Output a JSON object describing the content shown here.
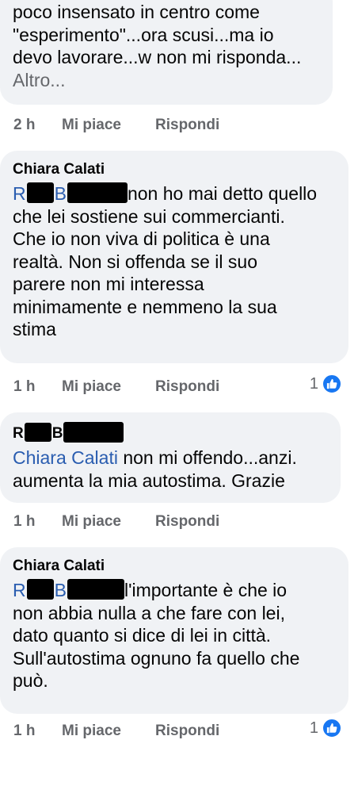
{
  "colors": {
    "bubble_bg": "#f0f2f5",
    "mention": "#2a5db0",
    "meta_text": "#65676b",
    "like_blue": "#1877f2"
  },
  "comments": [
    {
      "author": "",
      "lines": [
        "poco insensato in centro come",
        "\"esperimento\"...ora scusi...ma io",
        "devo lavorare...w non mi risponda..."
      ],
      "more": "Altro...",
      "time": "2 h",
      "like_label": "Mi piace",
      "reply_label": "Rispondi",
      "reactions": ""
    },
    {
      "author": "Chiara Calati",
      "mention_first": "R",
      "mention_second": "B",
      "first_line_rest": "non ho mai detto quello",
      "lines": [
        "che lei sostiene sui commercianti.",
        "Che io non viva di politica è una",
        "realtà. Non si offenda se il suo",
        "parere non mi interessa",
        "minimamente e nemmeno la sua",
        "stima"
      ],
      "time": "1 h",
      "like_label": "Mi piace",
      "reply_label": "Rispondi",
      "reactions": "1",
      "reaction_icon": "like-icon"
    },
    {
      "author_first": "R",
      "author_second": "B",
      "mention": "Chiara Calati",
      "first_line_rest": " non mi offendo...anzi.",
      "lines": [
        "aumenta la mia autostima. Grazie"
      ],
      "time": "1 h",
      "like_label": "Mi piace",
      "reply_label": "Rispondi"
    },
    {
      "author": "Chiara Calati",
      "mention_first": "R",
      "mention_second": "B",
      "first_line_rest": "l'importante è che io",
      "lines": [
        "non abbia nulla a che fare con lei,",
        "dato quanto si dice di lei in città.",
        "Sull'autostima ognuno fa quello che",
        "può."
      ],
      "time": "1 h",
      "like_label": "Mi piace",
      "reply_label": "Rispondi",
      "reactions": "1",
      "reaction_icon": "like-icon"
    }
  ]
}
